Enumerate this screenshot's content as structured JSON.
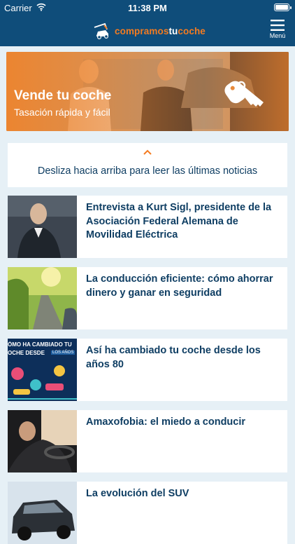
{
  "status_bar": {
    "carrier": "Carrier",
    "time": "11:38 PM"
  },
  "header": {
    "logo_main": "compramos",
    "logo_accent": "tu",
    "logo_end": "coche",
    "menu_label": "Menú",
    "colors": {
      "bar": "#0f4d7a",
      "brand": "#f47b20"
    }
  },
  "hero": {
    "title": "Vende tu coche",
    "subtitle": "Tasación rápida y fácil",
    "icon": "keys-icon"
  },
  "feed": {
    "hint": "Desliza hacia arriba para leer las últimas noticias",
    "icon": "chevron-up-icon"
  },
  "news": [
    {
      "title": "Entrevista a Kurt Sigl, presidente de la Asociación Federal Alemana de Movilidad Eléctrica"
    },
    {
      "title": "La conducción eficiente: cómo ahorrar dinero y ganar en seguridad"
    },
    {
      "title": "Así ha cambiado tu coche desde los años 80",
      "thumb_text_1": "ÓMO HA CAMBIADO TU",
      "thumb_text_2": "OCHE DESDE",
      "thumb_text_3": "LOS AÑOS"
    },
    {
      "title": "Amaxofobia: el miedo a conducir"
    },
    {
      "title": "La evolución del SUV"
    }
  ]
}
